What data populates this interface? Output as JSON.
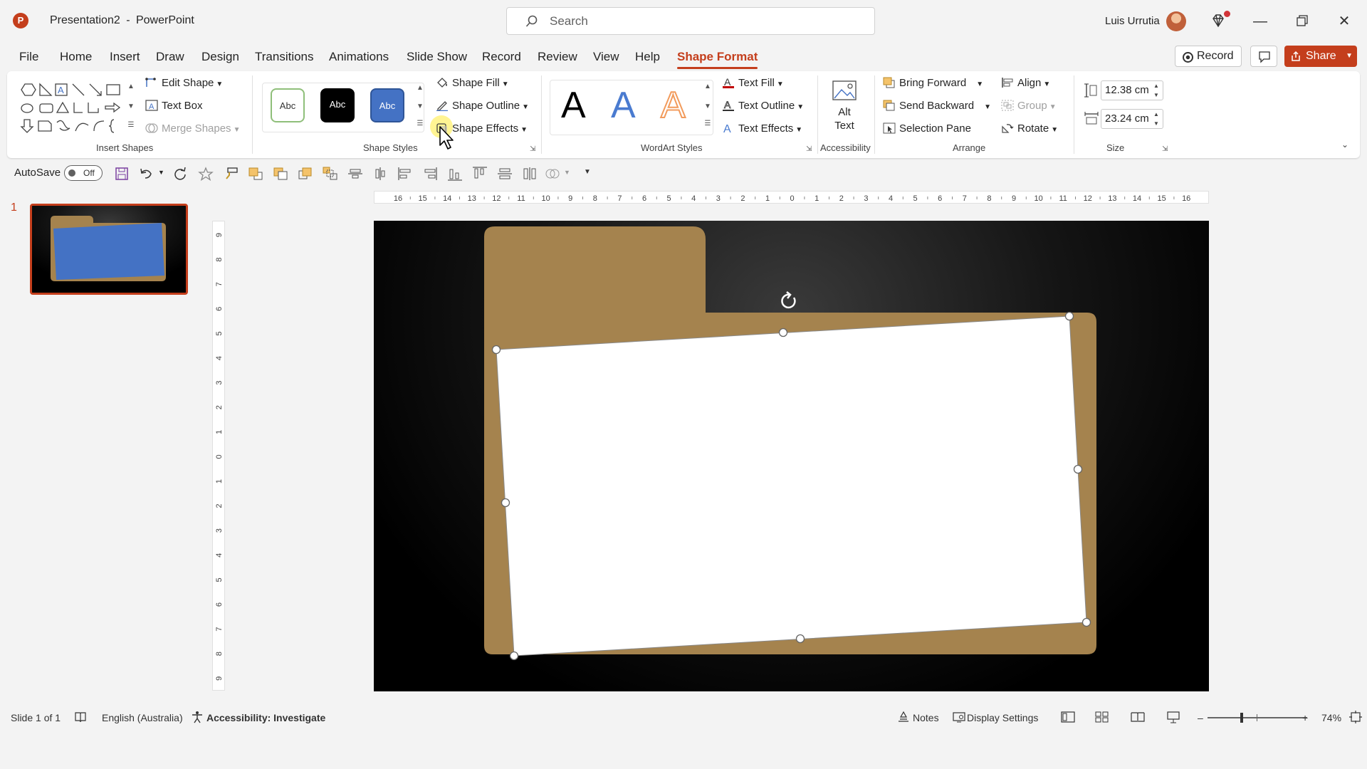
{
  "app": {
    "document_title": "Presentation2",
    "app_name": "PowerPoint",
    "title_separator": "-",
    "search_placeholder": "Search",
    "user_name": "Luis Urrutia"
  },
  "menu_tabs": [
    "File",
    "Home",
    "Insert",
    "Draw",
    "Design",
    "Transitions",
    "Animations",
    "Slide Show",
    "Record",
    "Review",
    "View",
    "Help",
    "Shape Format"
  ],
  "active_tab": "Shape Format",
  "top_right": {
    "record_label": "Record",
    "share_label": "Share"
  },
  "ribbon": {
    "insert_shapes": {
      "label": "Insert Shapes",
      "edit_shape": "Edit Shape",
      "text_box": "Text Box",
      "merge_shapes": "Merge Shapes"
    },
    "shape_styles": {
      "label": "Shape Styles",
      "chips": [
        "Abc",
        "Abc",
        "Abc"
      ],
      "shape_fill": "Shape Fill",
      "shape_outline": "Shape Outline",
      "shape_effects": "Shape Effects"
    },
    "wordart_styles": {
      "label": "WordArt Styles",
      "letters": [
        "A",
        "A",
        "A"
      ],
      "text_fill": "Text Fill",
      "text_outline": "Text Outline",
      "text_effects": "Text Effects"
    },
    "accessibility": {
      "label": "Accessibility",
      "alt_text_line1": "Alt",
      "alt_text_line2": "Text"
    },
    "arrange": {
      "label": "Arrange",
      "bring_forward": "Bring Forward",
      "send_backward": "Send Backward",
      "selection_pane": "Selection Pane",
      "align": "Align",
      "group": "Group",
      "rotate": "Rotate"
    },
    "size": {
      "label": "Size",
      "height": "12.38 cm",
      "width": "23.24 cm"
    }
  },
  "qat": {
    "autosave_label": "AutoSave",
    "autosave_state": "Off"
  },
  "thumbnails": {
    "slide_number": "1"
  },
  "rulers": {
    "horizontal": [
      "16",
      "15",
      "14",
      "13",
      "12",
      "11",
      "10",
      "9",
      "8",
      "7",
      "6",
      "5",
      "4",
      "3",
      "2",
      "1",
      "0",
      "1",
      "2",
      "3",
      "4",
      "5",
      "6",
      "7",
      "8",
      "9",
      "10",
      "11",
      "12",
      "13",
      "14",
      "15",
      "16"
    ],
    "vertical": [
      "9",
      "8",
      "7",
      "6",
      "5",
      "4",
      "3",
      "2",
      "1",
      "0",
      "1",
      "2",
      "3",
      "4",
      "5",
      "6",
      "7",
      "8",
      "9"
    ]
  },
  "status": {
    "slide_info": "Slide 1 of 1",
    "language": "English (Australia)",
    "accessibility": "Accessibility: Investigate",
    "notes": "Notes",
    "display_settings": "Display Settings",
    "zoom": "74%"
  },
  "colors": {
    "accent": "#c43e1c",
    "folder": "#a5834e",
    "selection_blue": "#4472c4",
    "wordart_blue": "#4a7bd0",
    "wordart_orange": "#f29b5c"
  }
}
